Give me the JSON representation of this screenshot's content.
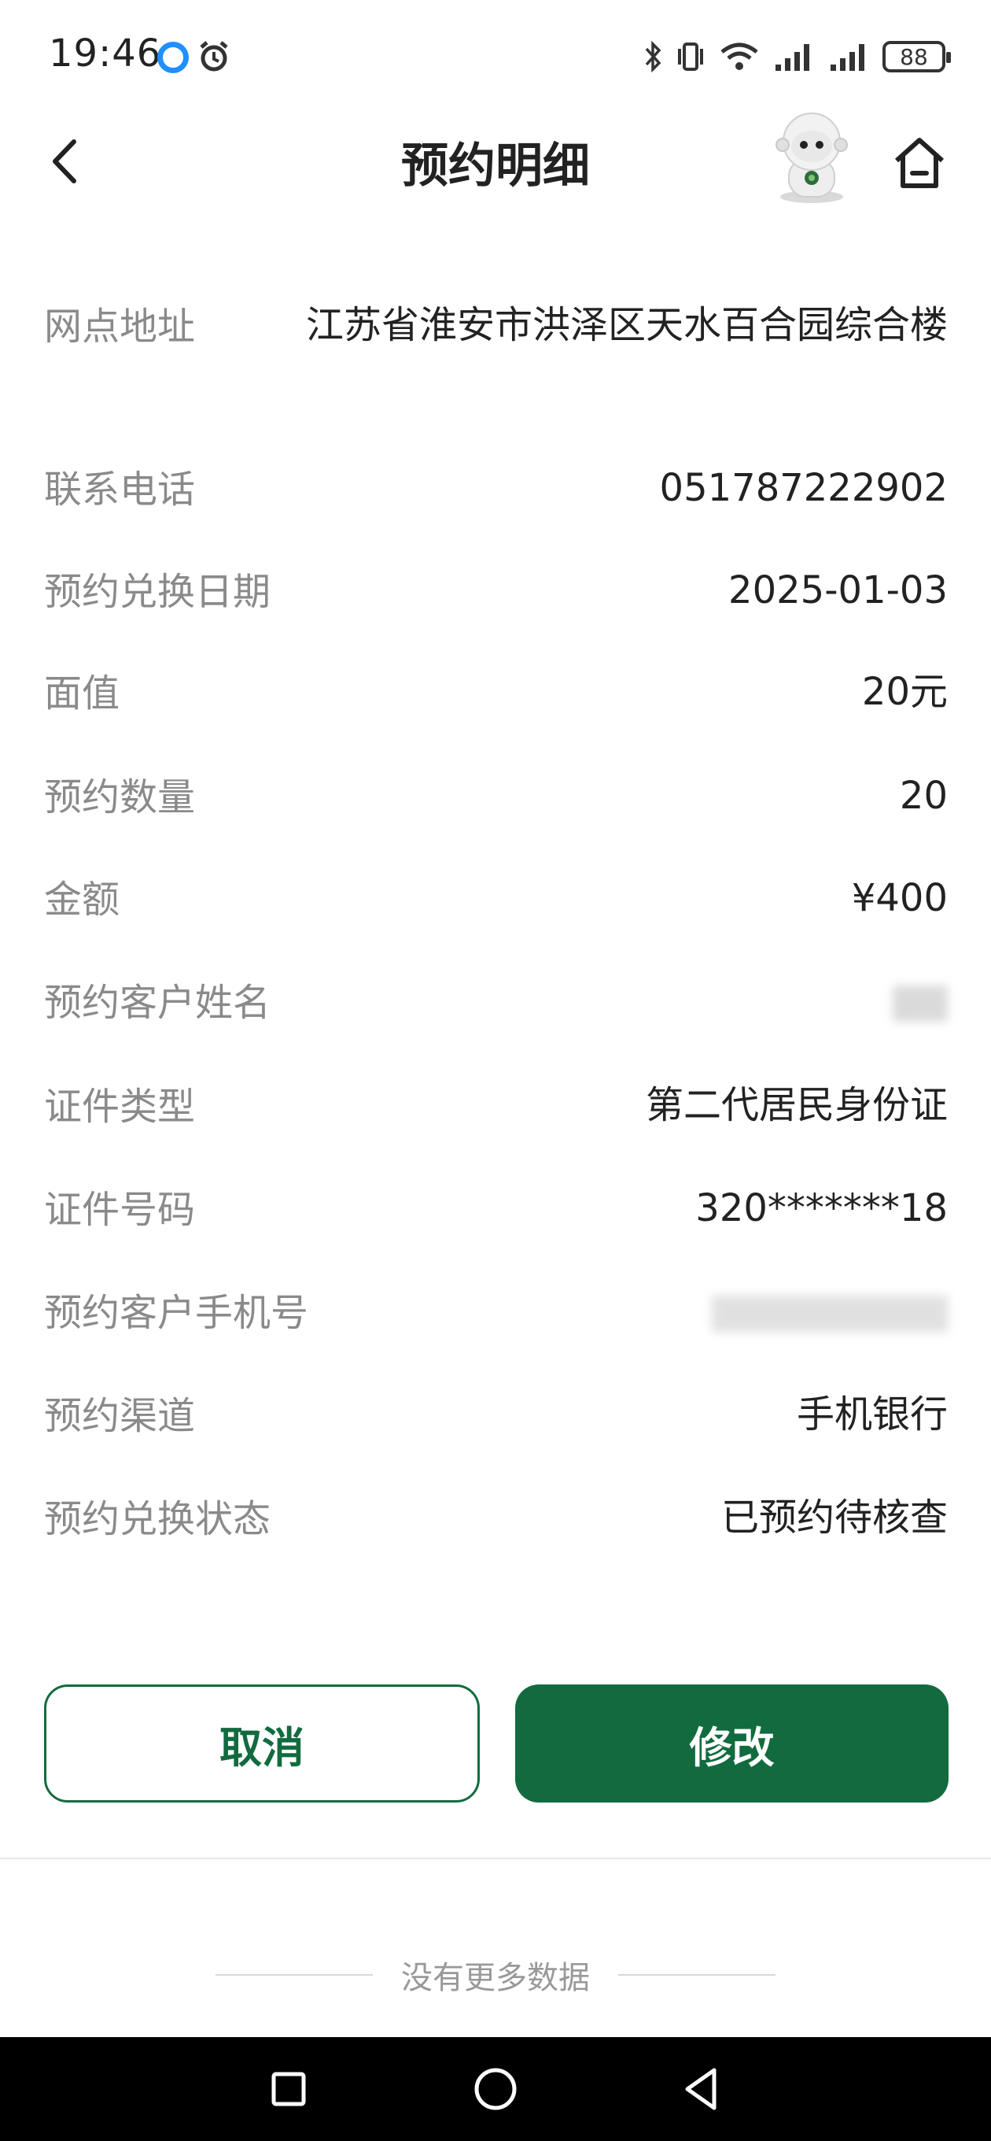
{
  "status_bar": {
    "time": "19:46",
    "battery": "88"
  },
  "header": {
    "title": "预约明细"
  },
  "details": {
    "partial_row_hint": "",
    "rows": [
      {
        "label": "网点地址",
        "value": "江苏省淮安市洪泽区天水百合园综合楼"
      },
      {
        "label": "联系电话",
        "value": "051787222902"
      },
      {
        "label": "预约兑换日期",
        "value": "2025-01-03"
      },
      {
        "label": "面值",
        "value": "20元"
      },
      {
        "label": "预约数量",
        "value": "20"
      },
      {
        "label": "金额",
        "value": "¥400"
      },
      {
        "label": "预约客户姓名",
        "value": ""
      },
      {
        "label": "证件类型",
        "value": "第二代居民身份证"
      },
      {
        "label": "证件号码",
        "value": "320*******18"
      },
      {
        "label": "预约客户手机号",
        "value": ""
      },
      {
        "label": "预约渠道",
        "value": "手机银行"
      },
      {
        "label": "预约兑换状态",
        "value": "已预约待核查"
      }
    ]
  },
  "actions": {
    "cancel_label": "取消",
    "modify_label": "修改"
  },
  "footer": {
    "no_more": "没有更多数据"
  },
  "colors": {
    "brand_green": "#126b3e",
    "label_gray": "#8a8a8a"
  },
  "icons": [
    "back-arrow-icon",
    "home-icon",
    "mascot-avatar",
    "bluetooth-icon",
    "vibrate-icon",
    "wifi-icon",
    "signal-icon",
    "battery-icon",
    "alarm-icon",
    "nav-square-icon",
    "nav-circle-icon",
    "nav-triangle-icon"
  ]
}
